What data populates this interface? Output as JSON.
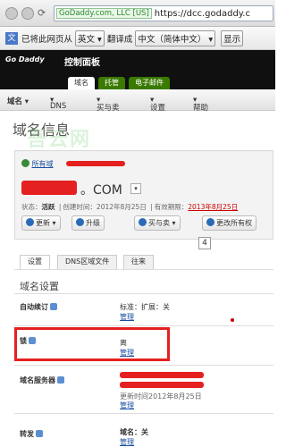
{
  "browser": {
    "ev_label": "GoDaddy.com, LLC [US]",
    "url": "https://dcc.godaddy.c"
  },
  "translate_bar": {
    "prefix": "已将此网页从",
    "from_lang": "英文",
    "middle": "翻译成",
    "to_lang": "中文（简体中文）",
    "show_label": "显示"
  },
  "header": {
    "logo_text": "Go Daddy",
    "panel_title": "控制面板",
    "tabs": [
      "域名",
      "托管",
      "电子邮件"
    ]
  },
  "menu": {
    "items": [
      "域名",
      "DNS",
      "买与卖",
      "设置",
      "帮助"
    ]
  },
  "page": {
    "title": "域名信息",
    "watermark": "吾云网",
    "all_link": "所有域",
    "domain_suffix": "。COM",
    "status_prefix": "状态：",
    "status_value": "活跃",
    "created": "创建时间：2012年8月25日",
    "expires_prefix": "有效期限：",
    "expires_value": "2013年8月25日",
    "badge_count": "4"
  },
  "actions": {
    "update": "更新",
    "upgrade": "升级",
    "buy_sell": "买与卖",
    "change_owner": "更改所有权"
  },
  "detail_tabs": [
    "设置",
    "DNS区域文件",
    "往来"
  ],
  "settings": {
    "heading": "域名设置",
    "auto_renew_label": "自动续订",
    "auto_renew_value": "标准：扩展：关",
    "auto_renew_link": "管理",
    "lock_label": "锁",
    "lock_value": "离",
    "lock_link": "管理",
    "ns_label": "域名服务器",
    "ns_updated": "更新时间2012年8月25日",
    "ns_link": "管理",
    "forward_label": "转发",
    "forward_value": "域名：关",
    "forward_link": "管理"
  },
  "colors": {
    "accent_green": "#3a7a00",
    "highlight_red": "#e52020",
    "link_blue": "#1a4fa0"
  }
}
